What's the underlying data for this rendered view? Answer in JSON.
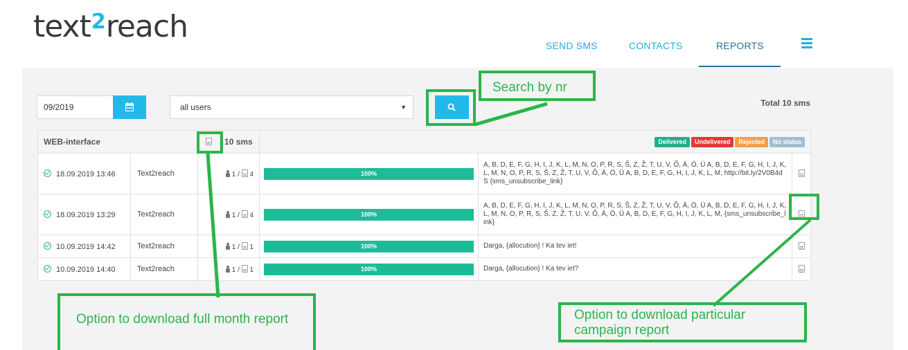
{
  "brand": {
    "logo_pre": "text",
    "logo_mid": "2",
    "logo_post": "reach"
  },
  "nav": {
    "items": [
      {
        "label": "SEND SMS"
      },
      {
        "label": "CONTACTS"
      },
      {
        "label": "REPORTS"
      }
    ],
    "active": "REPORTS"
  },
  "filters": {
    "date_value": "09/2019",
    "user_select": "all users",
    "total": "Total 10 sms"
  },
  "table": {
    "header": {
      "group": "WEB-interface",
      "count": "10 sms"
    },
    "legend": [
      {
        "label": "Delivered",
        "color": "#22b08a"
      },
      {
        "label": "Undelivered",
        "color": "#e53935"
      },
      {
        "label": "Rejected",
        "color": "#f0a04b"
      },
      {
        "label": "No status",
        "color": "#9fc0cf"
      }
    ],
    "rows": [
      {
        "time": "18.09.2019 13:46",
        "sender": "Text2reach",
        "recipients": "1",
        "parts": "4",
        "progress": "100%",
        "progress_pct": 100,
        "message": "A, B, D, E, F, G, H, I, J, K, L, M, N, O, P, R, S, Š, Z, Ž, T, U, V, Õ, Ä, Ö, Ü A, B, D, E, F, G, H, I, J, K, L, M, N, O, P, R, S, Š, Z, Ž, T, U, V, Õ, Ä, Ö, Ü A, B, D, E, F, G, H, I, J, K, L, M, http://bit.ly/2V0B4dS {sms_unsubscribe_link}"
      },
      {
        "time": "18.09.2019 13:29",
        "sender": "Text2reach",
        "recipients": "1",
        "parts": "4",
        "progress": "100%",
        "progress_pct": 100,
        "message": "A, B, D, E, F, G, H, I, J, K, L, M, N, O, P, R, S, Š, Z, Ž, T, U, V, Õ, Ä, Ö, Ü A, B, D, E, F, G, H, I, J, K, L, M, N, O, P, R, S, Š, Z, Ž, T, U, V, Õ, Ä, Ö, Ü A, B, D, E, F, G, H, I, J, K, L, M, {sms_unsubscribe_link}"
      },
      {
        "time": "10.09.2019 14:42",
        "sender": "Text2reach",
        "recipients": "1",
        "parts": "1",
        "progress": "100%",
        "progress_pct": 100,
        "message": "Darga, {allocution} ! Ka tev iet!"
      },
      {
        "time": "10.09.2019 14:40",
        "sender": "Text2reach",
        "recipients": "1",
        "parts": "1",
        "progress": "100%",
        "progress_pct": 100,
        "message": "Darga, {allocution} ! Ka tev iet?"
      }
    ]
  },
  "annotations": {
    "search": "Search by nr",
    "full_month": "Option to download full month report",
    "campaign": "Option to download particular campaign  report"
  },
  "colors": {
    "accent": "#21b9ea",
    "progress": "#1dbc97",
    "annotation": "#2bb54c"
  }
}
